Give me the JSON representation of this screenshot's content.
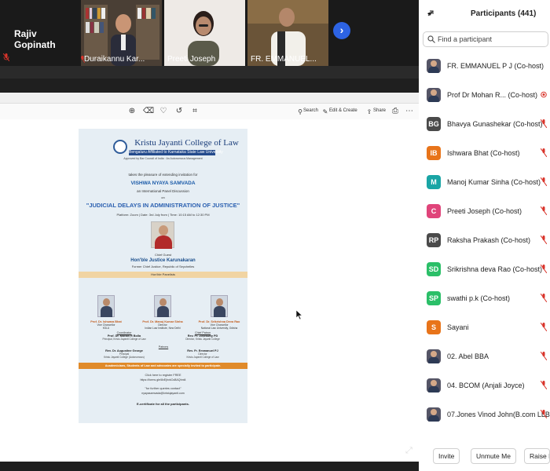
{
  "video": {
    "active_speaker": "Rajiv Gopinath",
    "tiles": [
      {
        "name": "Duraikannu Kar..."
      },
      {
        "name": "Preeti Joseph"
      },
      {
        "name": "FR. EMMANUEL..."
      }
    ],
    "next_icon": "chevron-right-icon"
  },
  "toolbar": {
    "search_label": "Search",
    "edit_label": "Edit & Create",
    "share_label": "Share"
  },
  "poster": {
    "college": "Kristu Jayanti College of Law",
    "location_band": "Bengaluru  Affiliated to Karnataka State Law University",
    "affiliation": "Approved by Bar Council of India  ·  An Autonomous Management",
    "takes_pleasure": "takes the pleasure of extending invitation for",
    "event_name": "VISHWA NYAYA SAMVADA",
    "event_type": "an International Panel Discussion",
    "on": "on",
    "theme": "\"JUDICIAL DELAYS IN ADMINISTRATION OF JUSTICE\"",
    "platform_line": "Platform: Zoom  |  Date: 3rd July from  |  Time: 10:15 AM to 12:30 PM",
    "chief_guest_heading": "Chief Guest",
    "chief_guest_name": "Hon'ble Justice Karunakaran",
    "chief_guest_role": "Former Chief Justice, Republic of Seychelles",
    "panelists_heading": "Hon'ble Panelists",
    "panelists": [
      {
        "name": "Prof. Dr. Ishwara Bhat",
        "role": "Vice Chancellor",
        "org": "KSLU"
      },
      {
        "name": "Prof. Dr. Manoj Kumar Sinha",
        "role": "Director",
        "org": "Indian Law Institute, New Delhi"
      },
      {
        "name": "Prof. Dr. Srikrishna Deva Rao",
        "role": "Vice Chancellor",
        "org": "National Law University, Odisha"
      }
    ],
    "coordinator": {
      "heading": "Coordinator",
      "name": "Prof. Dr. Mohan R Bolla",
      "role": "Principal, Kristu Jayanti College of Law"
    },
    "chief_patron": {
      "heading": "Chief Patron",
      "name": "Rev. Fr. Josekutty PD",
      "role": "Director, Kristu Jayanti College"
    },
    "patrons_heading": "Patrons",
    "patron_left": {
      "name": "Rev. Dr. Augustine George",
      "role": "Principal",
      "org": "Kristu Jayanti College (Autonomous)"
    },
    "patron_right": {
      "name": "Rev. Fr. Emmanuel PJ",
      "role": "Director",
      "org": "Kristu Jayanti College of Law"
    },
    "audience_band": "Academicians, Students of Law and advocates are specially invited to participate.",
    "register_line": "Click here to register FREE",
    "register_url": "https://forms.gle/8xEjhvkCsBAQhnt4",
    "queries_line": "\"for further queries contact\"",
    "queries_mail": "nyayasamvada@kristujayanti.com",
    "certificate_line": "E-certificate for all the participants."
  },
  "participants": {
    "title": "Participants (441)",
    "search_placeholder": "Find a participant",
    "list": [
      {
        "name": "FR. EMMANUEL P J (Co-host)",
        "avatar": "photo"
      },
      {
        "name": "Prof Dr Mohan R... (Co-host)",
        "avatar": "photo"
      },
      {
        "name": "Bhavya Gunashekar (Co-host)",
        "avatar": "BG",
        "color": "#4a4a4a"
      },
      {
        "name": "Ishwara Bhat (Co-host)",
        "avatar": "IB",
        "color": "#e8741a"
      },
      {
        "name": "Manoj Kumar Sinha (Co-host)",
        "avatar": "M",
        "color": "#1aa5a5"
      },
      {
        "name": "Preeti Joseph (Co-host)",
        "avatar": "C",
        "color": "#e0447a"
      },
      {
        "name": "Raksha Prakash (Co-host)",
        "avatar": "RP",
        "color": "#4a4a4a"
      },
      {
        "name": "Srikrishna deva Rao (Co-host)",
        "avatar": "SD",
        "color": "#2bbf68"
      },
      {
        "name": "swathi p.k (Co-host)",
        "avatar": "SP",
        "color": "#2bbf68"
      },
      {
        "name": "Sayani",
        "avatar": "S",
        "color": "#e8741a"
      },
      {
        "name": "02. Abel BBA",
        "avatar": "photo"
      },
      {
        "name": "04. BCOM (Anjali Joyce)",
        "avatar": "photo"
      },
      {
        "name": "07.Jones Vinod John(B.com LLB)",
        "avatar": "photo"
      }
    ],
    "buttons": {
      "invite": "Invite",
      "unmute": "Unmute Me",
      "raise": "Raise Hand"
    }
  },
  "colors": {
    "accent_blue": "#2d63e3",
    "muted_red": "#d9342b",
    "poster_bg": "#e6eef4",
    "poster_orange": "#e08a2a"
  }
}
